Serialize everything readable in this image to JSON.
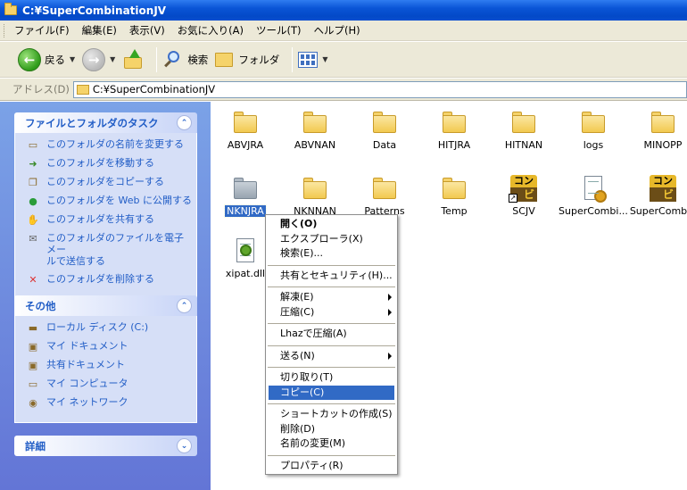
{
  "window": {
    "title": "C:¥SuperCombinationJV"
  },
  "menubar": [
    "ファイル(F)",
    "編集(E)",
    "表示(V)",
    "お気に入り(A)",
    "ツール(T)",
    "ヘルプ(H)"
  ],
  "toolbar": {
    "back": "戻る",
    "search": "検索",
    "folders": "フォルダ"
  },
  "address": {
    "label": "アドレス(D)",
    "value": "C:¥SuperCombinationJV"
  },
  "tasks": {
    "title": "ファイルとフォルダのタスク",
    "items": [
      {
        "label": "このフォルダの名前を変更する",
        "icon": "rename-icon"
      },
      {
        "label": "このフォルダを移動する",
        "icon": "move-icon"
      },
      {
        "label": "このフォルダをコピーする",
        "icon": "copy-icon"
      },
      {
        "label": "このフォルダを Web に公開する",
        "icon": "web-publish-icon"
      },
      {
        "label": "このフォルダを共有する",
        "icon": "share-icon"
      },
      {
        "label": "このフォルダのファイルを電子メー\nルで送信する",
        "icon": "email-icon"
      },
      {
        "label": "このフォルダを削除する",
        "icon": "delete-icon"
      }
    ]
  },
  "other": {
    "title": "その他",
    "items": [
      {
        "label": "ローカル ディスク (C:)",
        "icon": "local-disk-icon"
      },
      {
        "label": "マイ ドキュメント",
        "icon": "my-documents-icon"
      },
      {
        "label": "共有ドキュメント",
        "icon": "shared-documents-icon"
      },
      {
        "label": "マイ コンピュータ",
        "icon": "my-computer-icon"
      },
      {
        "label": "マイ ネットワーク",
        "icon": "my-network-icon"
      }
    ]
  },
  "details": {
    "title": "詳細"
  },
  "files": [
    {
      "name": "ABVJRA",
      "type": "folder"
    },
    {
      "name": "ABVNAN",
      "type": "folder"
    },
    {
      "name": "Data",
      "type": "folder"
    },
    {
      "name": "HITJRA",
      "type": "folder"
    },
    {
      "name": "HITNAN",
      "type": "folder"
    },
    {
      "name": "logs",
      "type": "folder"
    },
    {
      "name": "MINOPP",
      "type": "folder"
    },
    {
      "name": "NKNJRA",
      "type": "folder-selected"
    },
    {
      "name": "NKNNAN",
      "type": "folder"
    },
    {
      "name": "Patterns",
      "type": "folder"
    },
    {
      "name": "Temp",
      "type": "folder"
    },
    {
      "name": "SCJV",
      "type": "shortcut"
    },
    {
      "name": "SuperCombi...",
      "type": "document"
    },
    {
      "name": "SuperCombin",
      "type": "app"
    },
    {
      "name": "xipat.dll",
      "type": "dll"
    }
  ],
  "app_icon_text": {
    "top": "コン",
    "bottom": "ビ"
  },
  "context_menu": [
    {
      "label": "開く(O)",
      "bold": true
    },
    {
      "label": "エクスプローラ(X)"
    },
    {
      "label": "検索(E)..."
    },
    {
      "sep": true
    },
    {
      "label": "共有とセキュリティ(H)..."
    },
    {
      "sep": true
    },
    {
      "label": "解凍(E)",
      "submenu": true
    },
    {
      "label": "圧縮(C)",
      "submenu": true
    },
    {
      "sep": true
    },
    {
      "label": "Lhazで圧縮(A)"
    },
    {
      "sep": true
    },
    {
      "label": "送る(N)",
      "submenu": true
    },
    {
      "sep": true
    },
    {
      "label": "切り取り(T)"
    },
    {
      "label": "コピー(C)",
      "highlighted": true
    },
    {
      "sep": true
    },
    {
      "label": "ショートカットの作成(S)"
    },
    {
      "label": "削除(D)"
    },
    {
      "label": "名前の変更(M)"
    },
    {
      "sep": true
    },
    {
      "label": "プロパティ(R)"
    }
  ]
}
